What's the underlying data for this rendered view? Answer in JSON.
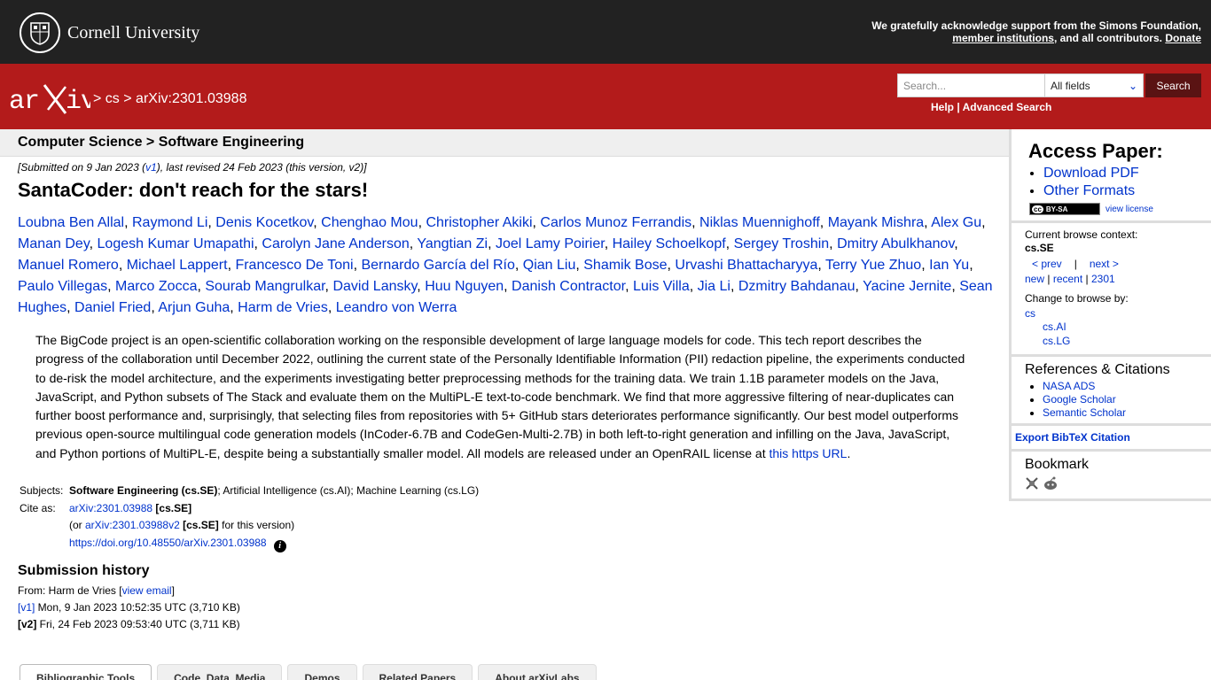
{
  "cornell": {
    "name": "Cornell University",
    "support_text": "We gratefully acknowledge support from the Simons Foundation,",
    "member_link": "member institutions",
    "contributors_text": ", and all contributors.",
    "donate": "Donate"
  },
  "arxiv": {
    "breadcrumb_sep1": ">",
    "breadcrumb_cs": "cs",
    "breadcrumb_sep2": ">",
    "breadcrumb_id": "arXiv:2301.03988",
    "search_placeholder": "Search...",
    "search_field": "All fields",
    "search_button": "Search",
    "help": "Help",
    "help_sep": "|",
    "advanced": "Advanced Search"
  },
  "subject_header": "Computer Science > Software Engineering",
  "paper": {
    "dateline_pre": "[Submitted on 9 Jan 2023 (",
    "dateline_v1": "v1",
    "dateline_post": "), last revised 24 Feb 2023 (this version, v2)]",
    "title": "SantaCoder: don't reach for the stars!",
    "authors": [
      "Loubna Ben Allal",
      "Raymond Li",
      "Denis Kocetkov",
      "Chenghao Mou",
      "Christopher Akiki",
      "Carlos Munoz Ferrandis",
      "Niklas Muennighoff",
      "Mayank Mishra",
      "Alex Gu",
      "Manan Dey",
      "Logesh Kumar Umapathi",
      "Carolyn Jane Anderson",
      "Yangtian Zi",
      "Joel Lamy Poirier",
      "Hailey Schoelkopf",
      "Sergey Troshin",
      "Dmitry Abulkhanov",
      "Manuel Romero",
      "Michael Lappert",
      "Francesco De Toni",
      "Bernardo García del Río",
      "Qian Liu",
      "Shamik Bose",
      "Urvashi Bhattacharyya",
      "Terry Yue Zhuo",
      "Ian Yu",
      "Paulo Villegas",
      "Marco Zocca",
      "Sourab Mangrulkar",
      "David Lansky",
      "Huu Nguyen",
      "Danish Contractor",
      "Luis Villa",
      "Jia Li",
      "Dzmitry Bahdanau",
      "Yacine Jernite",
      "Sean Hughes",
      "Daniel Fried",
      "Arjun Guha",
      "Harm de Vries",
      "Leandro von Werra"
    ],
    "abstract": "The BigCode project is an open-scientific collaboration working on the responsible development of large language models for code. This tech report describes the progress of the collaboration until December 2022, outlining the current state of the Personally Identifiable Information (PII) redaction pipeline, the experiments conducted to de-risk the model architecture, and the experiments investigating better preprocessing methods for the training data. We train 1.1B parameter models on the Java, JavaScript, and Python subsets of The Stack and evaluate them on the MultiPL-E text-to-code benchmark. We find that more aggressive filtering of near-duplicates can further boost performance and, surprisingly, that selecting files from repositories with 5+ GitHub stars deteriorates performance significantly. Our best model outperforms previous open-source multilingual code generation models (InCoder-6.7B and CodeGen-Multi-2.7B) in both left-to-right generation and infilling on the Java, JavaScript, and Python portions of MultiPL-E, despite being a substantially smaller model. All models are released under an OpenRAIL license at",
    "abstract_link": "this https URL",
    "abstract_end": "."
  },
  "meta": {
    "subjects_label": "Subjects:",
    "subjects_primary": "Software Engineering (cs.SE)",
    "subjects_rest": "; Artificial Intelligence (cs.AI); Machine Learning (cs.LG)",
    "cite_label": "Cite as:",
    "cite_id": "arXiv:2301.03988",
    "cite_tag": "[cs.SE]",
    "or_pre": "(or ",
    "cite_v2": "arXiv:2301.03988v2",
    "cite_v2_tag": "[cs.SE]",
    "or_post": " for this version)",
    "doi": "https://doi.org/10.48550/arXiv.2301.03988",
    "info_glyph": "i"
  },
  "history": {
    "title": "Submission history",
    "from_pre": "From: Harm de Vries [",
    "view_email": "view email",
    "from_post": "]",
    "v1": "[v1]",
    "v1_date": " Mon, 9 Jan 2023 10:52:35 UTC (3,710 KB)",
    "v2": "[v2]",
    "v2_date": " Fri, 24 Feb 2023 09:53:40 UTC (3,711 KB)"
  },
  "tabs": [
    "Bibliographic Tools",
    "Code, Data, Media",
    "Demos",
    "Related Papers",
    "About arXivLabs"
  ],
  "sidebar": {
    "access_title": "Access Paper:",
    "download_pdf": "Download PDF",
    "other_formats": "Other Formats",
    "cc_label": "cc",
    "cc_text": "BY-SA",
    "view_license": "view license",
    "context_label": "Current browse context:",
    "context_value": "cs.SE",
    "prev": "< prev",
    "nav_sep": "|",
    "next": "next >",
    "new": "new",
    "recent": "recent",
    "year": "2301",
    "change_label": "Change to browse by:",
    "cs": "cs",
    "cs_ai": "cs.AI",
    "cs_lg": "cs.LG",
    "refs_title": "References & Citations",
    "nasa": "NASA ADS",
    "google": "Google Scholar",
    "semantic": "Semantic Scholar",
    "bibtex": "Export BibTeX Citation",
    "bookmark_title": "Bookmark"
  },
  "colors": {
    "header_dark": "#222222",
    "arxiv_red": "#b31b1b",
    "link": "#0033cc"
  }
}
